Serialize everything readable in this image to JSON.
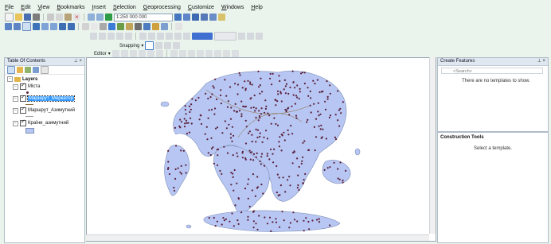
{
  "menu": [
    "File",
    "Edit",
    "View",
    "Bookmarks",
    "Insert",
    "Selection",
    "Geoprocessing",
    "Customize",
    "Windows",
    "Help"
  ],
  "toolbar": {
    "scale": "1:250 000 000",
    "editor_label": "Editor",
    "snapping_label": "Snapping"
  },
  "toc": {
    "title": "Table Of Contents",
    "pin": "\t ×",
    "layers_label": "Layers",
    "items": [
      {
        "label": "Міста"
      },
      {
        "label": "Маршрут_Меркатор"
      },
      {
        "label": "Маршрут_Азимутний"
      },
      {
        "label": "Країни_азимутний"
      }
    ]
  },
  "create_features": {
    "title": "Create Features",
    "search_placeholder": "<Search>",
    "empty_message": "There are no templates to show.",
    "construction_title": "Construction Tools",
    "construction_message": "Select a template."
  },
  "colors": {
    "land": "#b7c6f2",
    "land_stroke": "#7d8fb8",
    "cities": "#5a1f3a",
    "routes": "#8a6a3a",
    "selection": "#3399ff"
  },
  "icons": [
    "new-doc-icon",
    "open-icon",
    "save-icon",
    "print-icon",
    "cut-icon",
    "copy-icon",
    "paste-icon",
    "delete-icon",
    "undo-icon",
    "redo-icon",
    "add-data-icon",
    "zoom-in-icon",
    "zoom-out-icon",
    "pan-icon",
    "full-extent-icon",
    "identify-icon",
    "find-icon",
    "measure-icon",
    "catalog-icon",
    "arctoolbox-icon",
    "python-icon",
    "search-icon",
    "pin-icon",
    "close-icon"
  ]
}
